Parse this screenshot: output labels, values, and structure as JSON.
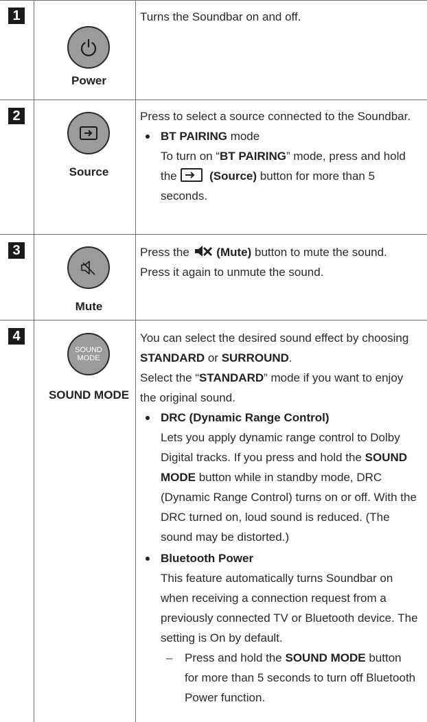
{
  "rows": [
    {
      "num": "1",
      "label": "Power",
      "icon": "power-icon",
      "desc": "Turns the Soundbar on and off."
    },
    {
      "num": "2",
      "label": "Source",
      "icon": "source-icon",
      "desc": "Press to select a source connected to the Soundbar.",
      "bullet_title": "BT PAIRING",
      "bullet_title_suffix": " mode",
      "bullet_text_1": "To turn on “",
      "bullet_text_bold": "BT PAIRING",
      "bullet_text_2": "” mode, press and hold the ",
      "bullet_text_button": "(Source)",
      "bullet_text_3": " button for more than 5 seconds."
    },
    {
      "num": "3",
      "label": "Mute",
      "icon": "mute-icon",
      "desc_1": "Press the ",
      "desc_button": "(Mute)",
      "desc_2": " button to mute the sound. Press it again to unmute the sound."
    },
    {
      "num": "4",
      "label": "SOUND MODE",
      "icon_line1": "SOUND",
      "icon_line2": "MODE",
      "p1_a": "You can select the desired sound effect by choosing ",
      "p1_b": "STANDARD",
      "p1_c": " or ",
      "p1_d": "SURROUND",
      "p1_e": ".",
      "p2_a": "Select the “",
      "p2_b": "STANDARD",
      "p2_c": "” mode if you want to enjoy the original sound.",
      "drc_title": "DRC (Dynamic Range Control)",
      "drc_a": "Lets you apply dynamic range control to Dolby Digital tracks. If you press and hold the ",
      "drc_b": "SOUND MODE",
      "drc_c": " button while in standby mode, DRC (Dynamic Range Control) turns on or off. With the DRC turned on, loud sound is reduced. (The sound may be distorted.)",
      "bt_title": "Bluetooth Power",
      "bt_text": "This feature automatically turns Soundbar on when receiving a connection request from a previously connected TV or Bluetooth device. The setting is On by default.",
      "sub_a": "Press and hold the ",
      "sub_b": "SOUND MODE",
      "sub_c": " button for more than 5 seconds to turn off Bluetooth Power function."
    }
  ]
}
